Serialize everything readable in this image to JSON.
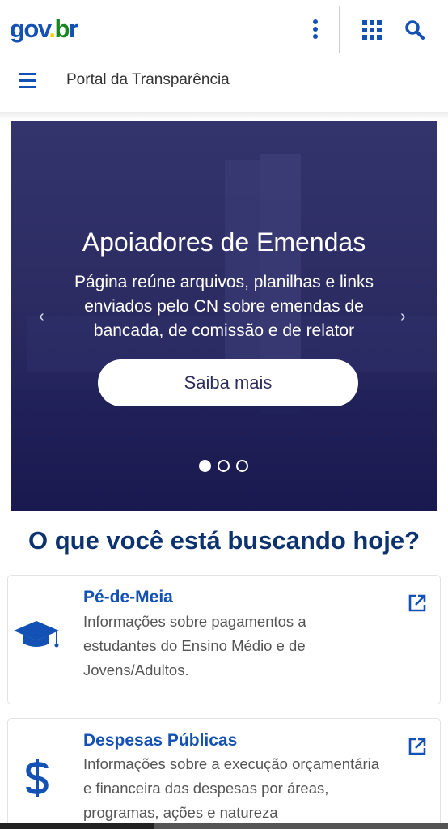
{
  "header": {
    "logo": {
      "part1": "gov",
      "part2": ".",
      "part3": "b",
      "part4": "r"
    },
    "site_title": "Portal da Transparência",
    "icons": [
      "more-vertical-icon",
      "apps-grid-icon",
      "search-icon",
      "hamburger-menu-icon"
    ]
  },
  "banner": {
    "title": "Apoiadores de Emendas",
    "description": "Página reúne arquivos, planilhas e links enviados pelo CN sobre emendas de bancada, de comissão e de relator",
    "button_label": "Saiba mais",
    "prev_arrow": "‹",
    "next_arrow": "›",
    "slides_count": 3,
    "active_slide": 1
  },
  "main": {
    "heading": "O que você está buscando hoje?",
    "cards": [
      {
        "title": "Pé-de-Meia",
        "text_lines": [
          "Informações sobre pagamentos a",
          "estudantes do Ensino Médio e de",
          "Jovens/Adultos."
        ],
        "icon": "graduation-cap-icon"
      },
      {
        "title": "Despesas Públicas",
        "text_lines": [
          "Informações sobre a execução orçamentária",
          "e financeira das despesas por áreas,",
          "programas, ações e natureza"
        ],
        "icon": "dollar-sign-icon"
      }
    ]
  },
  "colors": {
    "primary_blue": "#1351b4",
    "heading_blue": "#0c326f",
    "banner_bg": "#2c2c63",
    "logo_yellow": "#ffcd07",
    "logo_green": "#168821"
  }
}
